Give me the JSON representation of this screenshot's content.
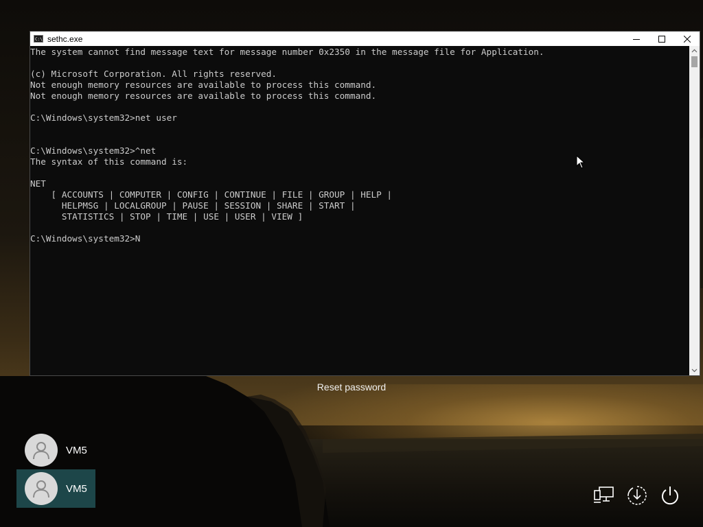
{
  "console": {
    "title": "sethc.exe",
    "lines": [
      "The system cannot find message text for message number 0x2350 in the message file for Application.",
      "",
      "(c) Microsoft Corporation. All rights reserved.",
      "Not enough memory resources are available to process this command.",
      "Not enough memory resources are available to process this command.",
      "",
      "C:\\Windows\\system32>net user",
      "",
      "",
      "C:\\Windows\\system32>^net",
      "The syntax of this command is:",
      "",
      "NET",
      "    [ ACCOUNTS | COMPUTER | CONFIG | CONTINUE | FILE | GROUP | HELP |",
      "      HELPMSG | LOCALGROUP | PAUSE | SESSION | SHARE | START |",
      "      STATISTICS | STOP | TIME | USE | USER | VIEW ]",
      "",
      "C:\\Windows\\system32>N"
    ],
    "icons": {
      "app": "cmd-icon",
      "minimize": "minimize-icon",
      "maximize": "maximize-icon",
      "close": "close-icon"
    }
  },
  "login": {
    "reset_password": "Reset password",
    "users": [
      {
        "name": "VM5",
        "icon": "user-avatar-icon"
      },
      {
        "name": "VM5",
        "icon": "user-avatar-icon",
        "selected": true
      }
    ],
    "system_icons": [
      "network-icon",
      "ease-of-access-icon",
      "power-icon"
    ]
  },
  "colors": {
    "console_bg": "#0c0c0c",
    "console_text": "#cccccc",
    "selected_user_bg": "#1d4649"
  }
}
